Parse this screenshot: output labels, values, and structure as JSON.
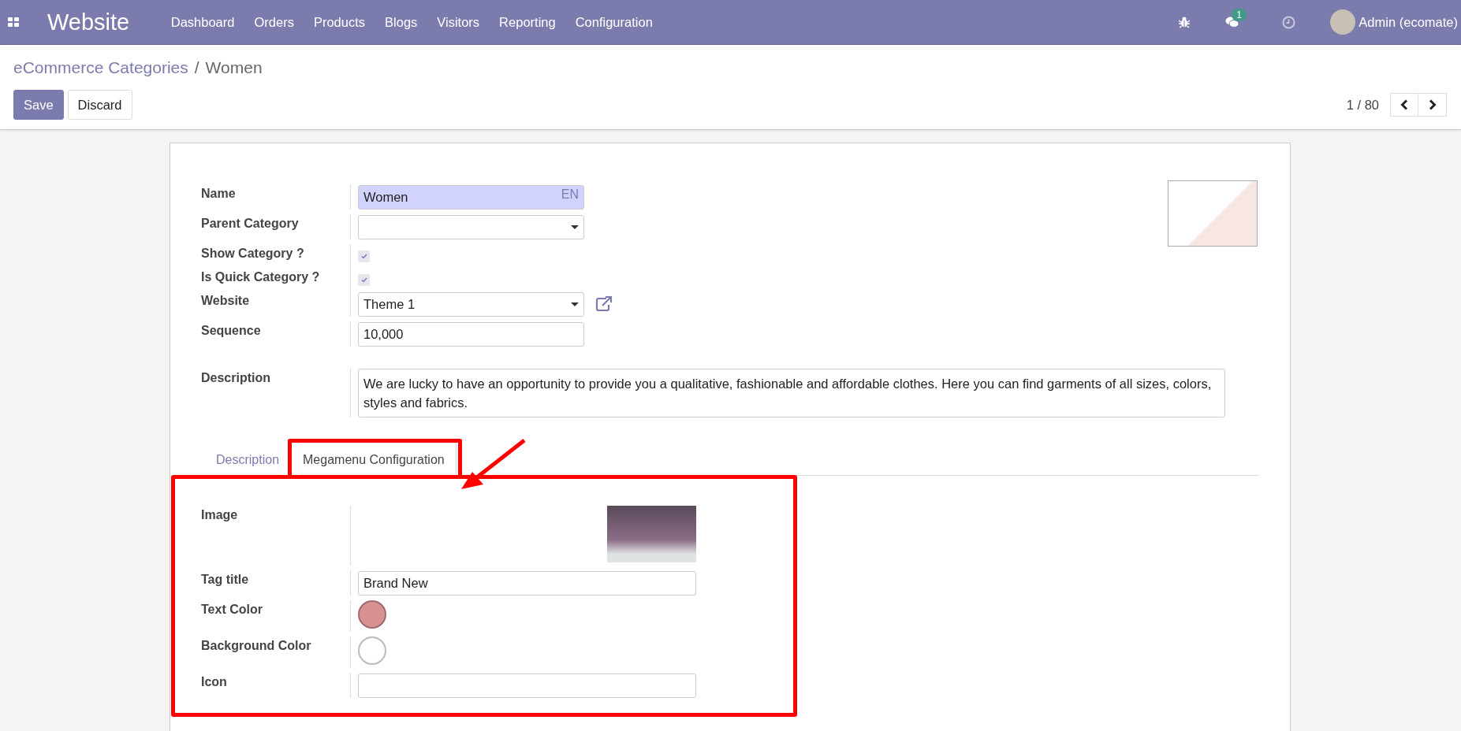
{
  "navbar": {
    "app_name": "Website",
    "menu": [
      "Dashboard",
      "Orders",
      "Products",
      "Blogs",
      "Visitors",
      "Reporting",
      "Configuration"
    ],
    "chat_badge": "1",
    "user": "Admin (ecomate)"
  },
  "breadcrumb": {
    "items": [
      {
        "label": "eCommerce Categories",
        "kind": "link"
      },
      {
        "label": "Women",
        "kind": "current"
      }
    ],
    "separator": "/"
  },
  "buttons": [
    {
      "label": "Save",
      "kind": "primary"
    },
    {
      "label": "Discard",
      "kind": "secondary"
    }
  ],
  "pager": "1 / 80",
  "form": {
    "fields": [
      {
        "label": "Name",
        "kind": "text",
        "value": "Women",
        "lang": "EN",
        "required": true
      },
      {
        "label": "Parent Category",
        "kind": "select"
      },
      {
        "label": "Show Category ?",
        "kind": "checkbox",
        "checked": true
      },
      {
        "label": "Is Quick Category ?",
        "kind": "checkbox",
        "checked": true
      },
      {
        "label": "Website",
        "kind": "select",
        "value": "Theme 1",
        "external_link": true
      },
      {
        "label": "Sequence",
        "kind": "text",
        "value": "10,000"
      }
    ],
    "description": {
      "label": "Description",
      "value": "We are lucky to have an opportunity to provide you a qualitative, fashionable and affordable clothes. Here you can find garments of all sizes, colors, styles and fabrics."
    }
  },
  "tabs": [
    {
      "label": "Description",
      "selected": false
    },
    {
      "label": "Megamenu Configuration",
      "selected": true
    }
  ],
  "megamenu": {
    "fields": [
      {
        "label": "Image",
        "kind": "image"
      },
      {
        "label": "Tag title",
        "kind": "text",
        "value": "Brand New"
      },
      {
        "label": "Text Color",
        "kind": "color",
        "color": "#d99292"
      },
      {
        "label": "Background Color",
        "kind": "color",
        "color": "#ffffff"
      },
      {
        "label": "Icon",
        "kind": "text"
      }
    ]
  }
}
